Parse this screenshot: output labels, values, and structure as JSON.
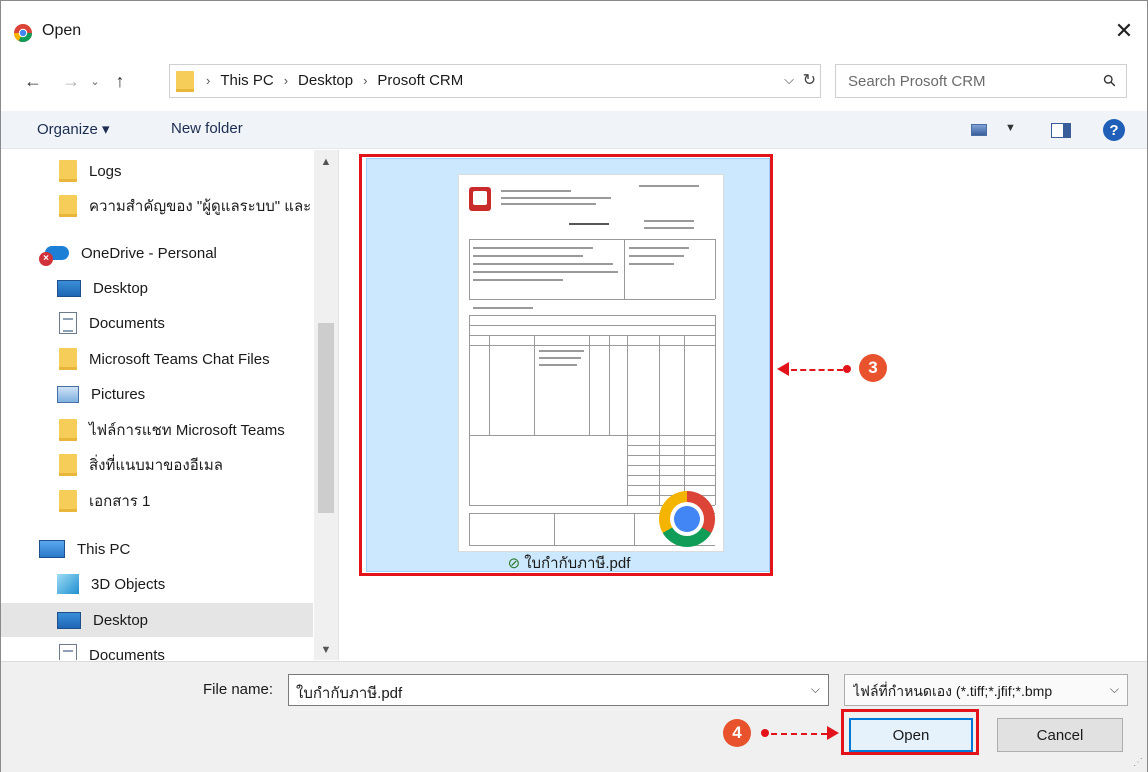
{
  "window": {
    "title": "Open",
    "close_glyph": "✕"
  },
  "address": {
    "crumbs": [
      "This PC",
      "Desktop",
      "Prosoft CRM"
    ],
    "separator": "›"
  },
  "search": {
    "placeholder": "Search Prosoft CRM"
  },
  "toolbar": {
    "organize_label": "Organize ▾",
    "new_folder_label": "New folder",
    "help_glyph": "?"
  },
  "nav": {
    "items": [
      {
        "label": "Logs",
        "icon": "folder-icon"
      },
      {
        "label": "ความสำคัญของ \"ผู้ดูแลระบบ\" และ",
        "icon": "folder-icon"
      },
      {
        "label": "OneDrive - Personal",
        "icon": "onedrive-icon"
      },
      {
        "label": "Desktop",
        "icon": "desktop-icon"
      },
      {
        "label": "Documents",
        "icon": "documents-icon"
      },
      {
        "label": "Microsoft Teams Chat Files",
        "icon": "folder-icon"
      },
      {
        "label": "Pictures",
        "icon": "pictures-icon"
      },
      {
        "label": "ไฟล์การแชท Microsoft Teams",
        "icon": "folder-icon"
      },
      {
        "label": "สิ่งที่แนบมาของอีเมล",
        "icon": "folder-icon"
      },
      {
        "label": "เอกสาร 1",
        "icon": "folder-icon"
      },
      {
        "label": "This PC",
        "icon": "this-pc-icon"
      },
      {
        "label": "3D Objects",
        "icon": "3d-objects-icon"
      },
      {
        "label": "Desktop",
        "icon": "desktop-icon",
        "selected": true
      },
      {
        "label": "Documents",
        "icon": "documents-icon"
      }
    ]
  },
  "content": {
    "file_name": "ใบกำกับภาษี.pdf",
    "check_glyph": "⊘"
  },
  "callouts": {
    "step3": "3",
    "step4": "4"
  },
  "footer": {
    "file_name_label": "File name:",
    "file_name_value": "ใบกำกับภาษี.pdf",
    "filter_value": "ไฟล์ที่กำหนดเอง (*.tiff;*.jfif;*.bmp",
    "open_label": "Open",
    "cancel_label": "Cancel"
  },
  "colors": {
    "accent": "#0078d7",
    "callout_red": "#e3131b",
    "badge_orange": "#e8532e",
    "selection_blue": "#cce8ff"
  }
}
